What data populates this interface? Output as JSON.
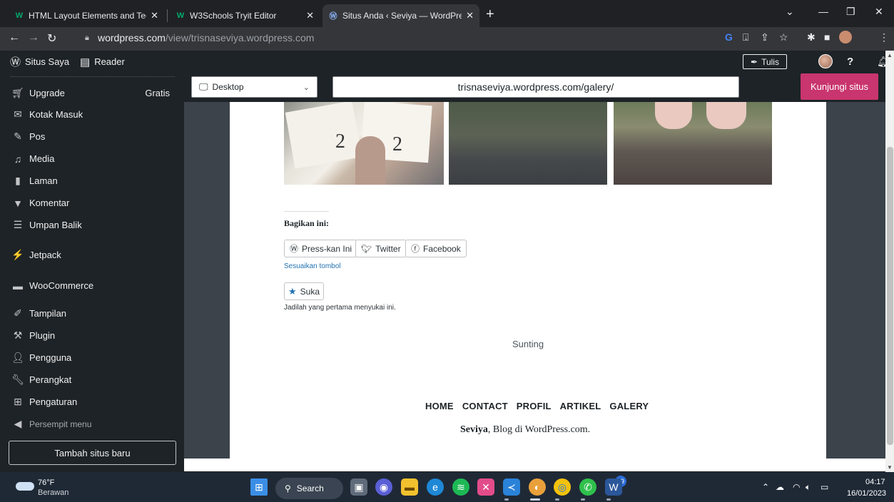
{
  "browser": {
    "tabs": [
      {
        "title": "HTML Layout Elements and Tech",
        "favicon": "w3schools-icon"
      },
      {
        "title": "W3Schools Tryit Editor",
        "favicon": "w3schools-icon"
      },
      {
        "title": "Situs Anda ‹ Seviya — WordPress",
        "favicon": "wordpress-icon"
      }
    ],
    "url_domain": "wordpress.com",
    "url_path": "/view/trisnaseviya.wordpress.com"
  },
  "adminbar": {
    "my_site": "Situs Saya",
    "reader": "Reader",
    "write": "Tulis"
  },
  "sidebar": {
    "items": [
      {
        "label": "Upgrade",
        "badge": "Gratis",
        "icon": "cart-icon"
      },
      {
        "label": "Kotak Masuk",
        "icon": "mail-icon"
      },
      {
        "label": "Pos",
        "icon": "pin-icon"
      },
      {
        "label": "Media",
        "icon": "media-icon"
      },
      {
        "label": "Laman",
        "icon": "page-icon"
      },
      {
        "label": "Komentar",
        "icon": "comment-icon"
      },
      {
        "label": "Umpan Balik",
        "icon": "feedback-icon"
      },
      {
        "label": "Jetpack",
        "icon": "jetpack-icon"
      },
      {
        "label": "WooCommerce",
        "icon": "woo-icon"
      },
      {
        "label": "Tampilan",
        "icon": "brush-icon"
      },
      {
        "label": "Plugin",
        "icon": "plugin-icon"
      },
      {
        "label": "Pengguna",
        "icon": "user-icon"
      },
      {
        "label": "Perangkat",
        "icon": "wrench-icon"
      },
      {
        "label": "Pengaturan",
        "icon": "settings-icon"
      }
    ],
    "collapse": "Persempit menu",
    "add_site": "Tambah situs baru"
  },
  "preview": {
    "device": "Desktop",
    "url": "trisnaseviya.wordpress.com/galery/",
    "visit": "Kunjungi situs"
  },
  "page": {
    "share_title": "Bagikan ini:",
    "share_buttons": [
      "Press-kan Ini",
      "Twitter",
      "Facebook"
    ],
    "customize": "Sesuaikan tombol",
    "like": "Suka",
    "like_note": "Jadilah yang pertama menyukai ini.",
    "edit": "Sunting",
    "footer_nav": [
      "HOME",
      "CONTACT",
      "PROFIL",
      "ARTIKEL",
      "GALERY"
    ],
    "footer_site": "Seviya",
    "footer_rest": ", Blog di WordPress.com."
  },
  "taskbar": {
    "temp": "76°F",
    "weather": "Berawan",
    "search": "Search",
    "whatsapp_badge": "39",
    "time": "04:17",
    "date": "16/01/2023"
  }
}
